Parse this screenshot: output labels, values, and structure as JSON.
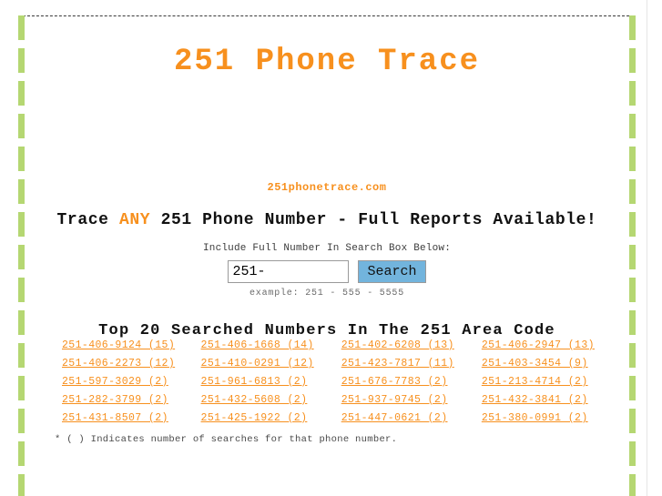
{
  "site": {
    "title": "251 Phone Trace",
    "domain": "251phonetrace.com",
    "tagline_before": "Trace ",
    "tagline_highlight": "ANY",
    "tagline_after": " 251 Phone Number - Full Reports Available!"
  },
  "search": {
    "hint": "Include Full Number In Search Box Below:",
    "value": "251-",
    "placeholder": "",
    "button_label": "Search",
    "example": "example: 251 - 555 - 5555"
  },
  "top20": {
    "heading": "Top 20 Searched Numbers In The 251 Area Code",
    "footnote": "* ( ) Indicates number of searches for that phone number.",
    "rows": [
      [
        "251-406-9124 (15)",
        "251-406-1668 (14)",
        "251-402-6208 (13)",
        "251-406-2947 (13)"
      ],
      [
        "251-406-2273 (12)",
        "251-410-0291 (12)",
        "251-423-7817 (11)",
        "251-403-3454 (9)"
      ],
      [
        "251-597-3029 (2)",
        "251-961-6813 (2)",
        "251-676-7783 (2)",
        "251-213-4714 (2)"
      ],
      [
        "251-282-3799 (2)",
        "251-432-5608 (2)",
        "251-937-9745 (2)",
        "251-432-3841 (2)"
      ],
      [
        "251-431-8507 (2)",
        "251-425-1922 (2)",
        "251-447-0621 (2)",
        "251-380-0991 (2)"
      ]
    ]
  },
  "colors": {
    "accent_orange": "#f7901e",
    "rail_green": "#b5d772",
    "button_blue": "#72b4dd"
  }
}
